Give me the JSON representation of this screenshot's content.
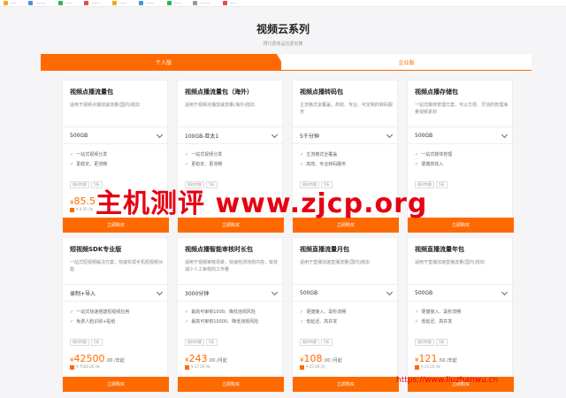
{
  "bookmarks": [
    {
      "label": "····",
      "color": "#f5a623"
    },
    {
      "label": "·······",
      "color": "#4a90e2"
    },
    {
      "label": "·····",
      "color": "#2db55d"
    },
    {
      "label": "······",
      "color": "#e24a4a"
    },
    {
      "label": "·····",
      "color": "#f5a623"
    },
    {
      "label": "······",
      "color": "#4a90e2"
    },
    {
      "label": "·····",
      "color": "#2db55d"
    },
    {
      "label": "·······",
      "color": "#999999"
    },
    {
      "label": "·····",
      "color": "#e24a4a"
    }
  ],
  "header": {
    "title": "视频云系列",
    "subtitle": "预付费单品包更划算"
  },
  "tabs": {
    "personal": "个人版",
    "enterprise": "企业版"
  },
  "buy_label": "立即购买",
  "cards": [
    {
      "title": "视频点播流量包",
      "desc": "适用于视频点播加速流量(国内)抵扣",
      "select": "500GB",
      "features": [
        "一站式视频分发",
        "更稳定、更流畅"
      ],
      "tags": [
        "限时特惠",
        "5折"
      ],
      "currency": "¥",
      "price": "85.5",
      "unit": "",
      "orig": "¥ 9.50 /年"
    },
    {
      "title": "视频点播流量包（海外）",
      "desc": "适用于视频点播加速流量(海外)抵扣",
      "select": "100GB-亚太1",
      "features": [
        "一站式视频分发",
        "更稳定、更流畅"
      ],
      "tags": [
        "限时特惠",
        "5折"
      ],
      "currency": "¥",
      "price": "",
      "unit": "",
      "orig": ""
    },
    {
      "title": "视频点播转码包",
      "desc": "主流格式全覆盖，高效、专业、可定制的转码服务",
      "select": "5千分钟",
      "features": [
        "主流格式全覆盖",
        "高效、专业转码服务"
      ],
      "tags": [
        "限时特惠",
        "5折"
      ],
      "currency": "¥",
      "price": "",
      "unit": "",
      "orig": ""
    },
    {
      "title": "视频点播存储包",
      "desc": "一站式媒体管理方案，可以方便、灵活的管理海量视频素材",
      "select": "500GB",
      "features": [
        "一站式媒体管理",
        "便捷高效入"
      ],
      "tags": [
        "限时特惠",
        "5折"
      ],
      "currency": "¥",
      "price": "",
      "unit": "",
      "orig": ""
    },
    {
      "title": "短视频SDK专业版",
      "desc": "一站式短视频解决方案，快速实现手机短视频功能",
      "select": "录制+导入",
      "features": [
        "一站式快速搭建短视频应用",
        "免费人脸识别+贴纸"
      ],
      "tags": [
        "限时特惠",
        "5折"
      ],
      "currency": "¥",
      "price": "42500",
      "unit": ".00 /年起",
      "orig": "¥ 7500.00 /年"
    },
    {
      "title": "视频点播智能审核时长包",
      "desc": "适用于视频审核场景，快速检测违规内容，有效减少人工审核的工作量",
      "select": "3000分钟",
      "features": [
        "最高可审核1000、降低违规风险",
        "最高可审核10000、降低违规风险"
      ],
      "tags": [
        "限时特惠",
        "5折"
      ],
      "currency": "¥",
      "price": "243",
      "unit": ".00 /月起",
      "orig": "¥ 27.00 /年"
    },
    {
      "title": "视频直播流量月包",
      "desc": "适用于直播加速直播流量(国内)抵扣",
      "select": "500GB",
      "features": [
        "便捷接入、毫秒流畅",
        "低延迟、高并发"
      ],
      "tags": [
        "限时特惠",
        "5折"
      ],
      "currency": "¥",
      "price": "108",
      "unit": ".00 /月起",
      "orig": "¥ 27.00 /月"
    },
    {
      "title": "视频直播流量年包",
      "desc": "适用于直播加速直播流量(国内)抵扣",
      "select": "500GB",
      "features": [
        "便捷接入、毫秒流畅",
        "低延迟、高并发"
      ],
      "tags": [
        "限时特惠",
        "5折"
      ],
      "currency": "¥",
      "price": "121",
      "unit": ".50 /年起",
      "orig": "¥ 13.50 /年"
    }
  ],
  "watermark": {
    "text": "主机测评 www.zjcp.org",
    "url": "https://www.liuzhanwu.cn"
  },
  "colors": {
    "accent": "#ff6a00",
    "watermark": "#e60012"
  }
}
